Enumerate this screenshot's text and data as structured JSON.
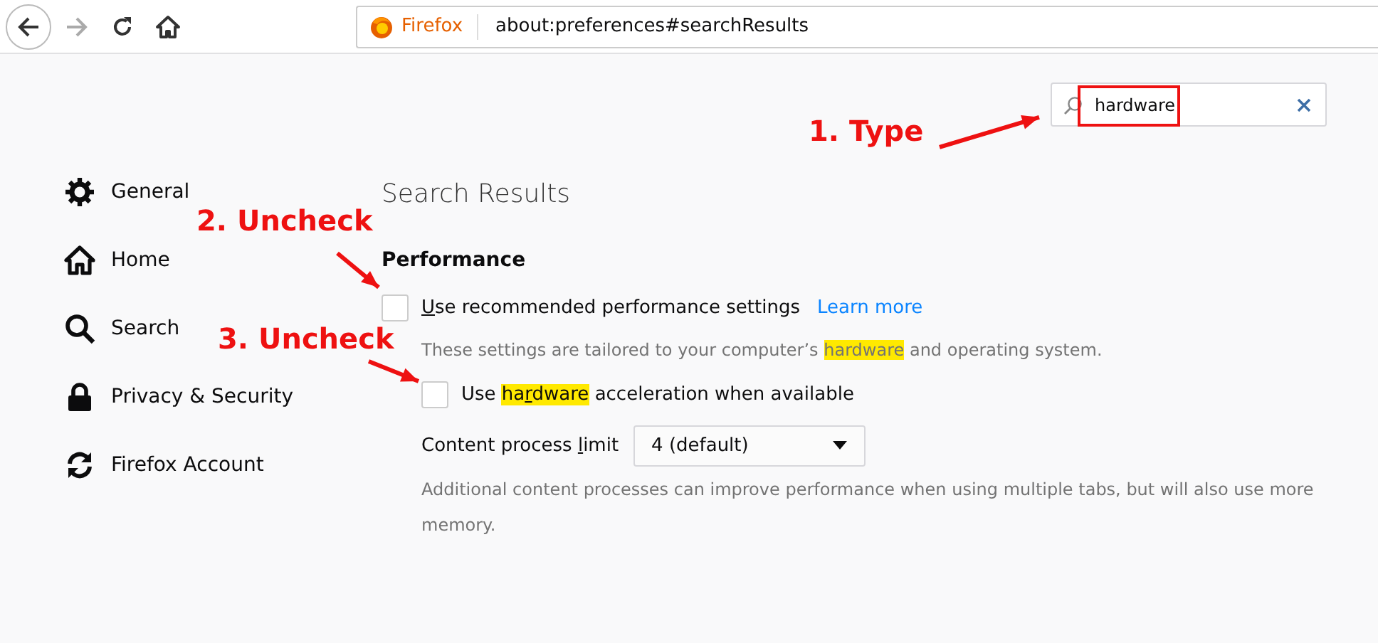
{
  "toolbar": {
    "back_enabled": true,
    "forward_enabled": false,
    "identity": "Firefox",
    "url": "about:preferences#searchResults"
  },
  "search": {
    "value": "hardware"
  },
  "sidebar": {
    "items": [
      {
        "label": "General"
      },
      {
        "label": "Home"
      },
      {
        "label": "Search"
      },
      {
        "label": "Privacy & Security"
      },
      {
        "label": "Firefox Account"
      }
    ]
  },
  "main": {
    "title": "Search Results",
    "section": "Performance",
    "settings": [
      {
        "kind": "checkbox",
        "checked": false,
        "label": [
          {
            "text": "U",
            "underline": true
          },
          {
            "text": "se recommended performance settings"
          }
        ],
        "link": "Learn more",
        "description": [
          {
            "text": "These settings are tailored to your computer’s "
          },
          {
            "text": "hardware",
            "highlight": true
          },
          {
            "text": " and operating system."
          }
        ]
      },
      {
        "kind": "checkbox",
        "checked": false,
        "label": [
          {
            "text": "Use "
          },
          {
            "text": "ha",
            "highlight": true
          },
          {
            "text": "r",
            "highlight": true,
            "underline": true
          },
          {
            "text": "dware",
            "highlight": true
          },
          {
            "text": " acceleration when available"
          }
        ]
      },
      {
        "kind": "dropdown",
        "label": [
          {
            "text": "Content process "
          },
          {
            "text": "l",
            "underline": true
          },
          {
            "text": "imit"
          }
        ],
        "value": "4 (default)",
        "description": [
          {
            "text": "Additional content processes can improve performance when using multiple tabs, but will also use more memory."
          }
        ]
      }
    ]
  },
  "annotations": [
    {
      "text": "1. Type"
    },
    {
      "text": "2. Uncheck"
    },
    {
      "text": "3. Uncheck"
    }
  ]
}
